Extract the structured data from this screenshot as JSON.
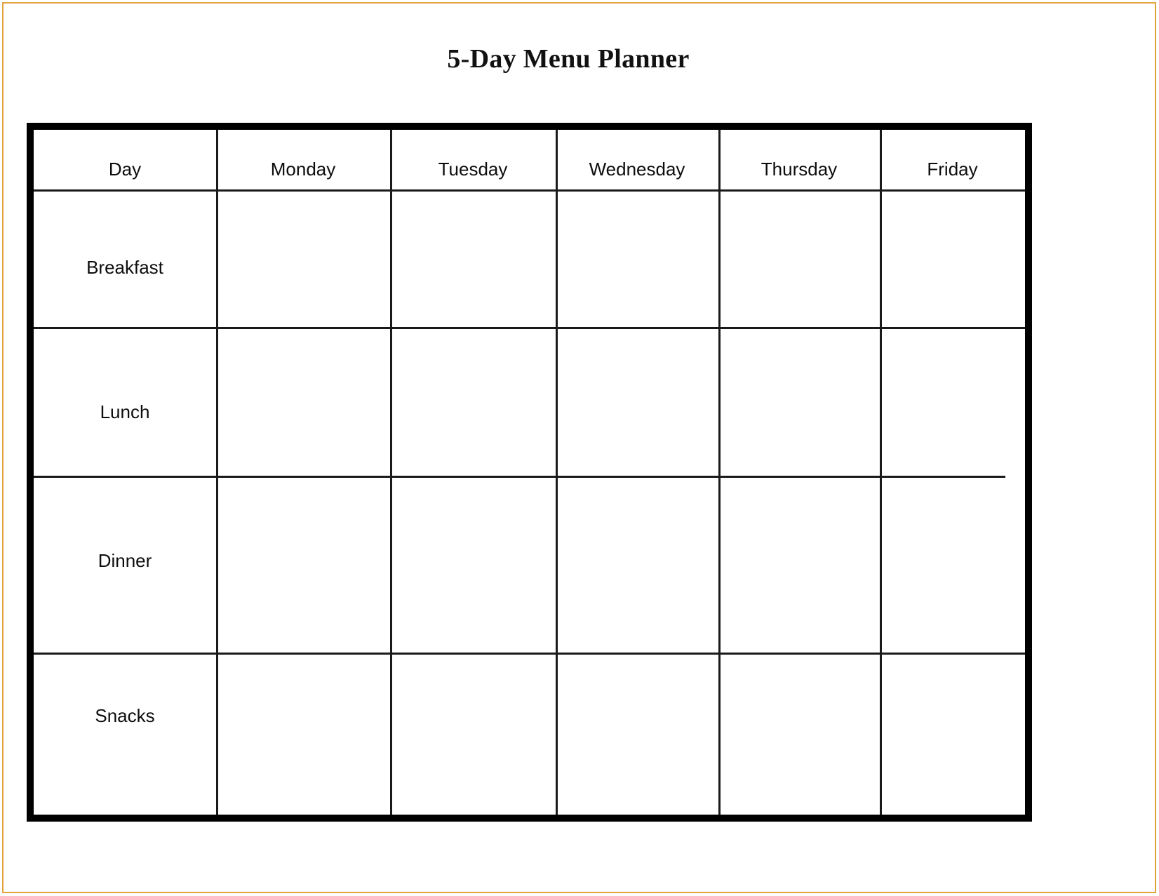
{
  "document": {
    "title": "5-Day Menu Planner",
    "frame_color": "#e0a33e",
    "border_color": "#000000"
  },
  "table": {
    "columns": [
      {
        "key": "day",
        "label": "Day"
      },
      {
        "key": "monday",
        "label": "Monday"
      },
      {
        "key": "tuesday",
        "label": "Tuesday"
      },
      {
        "key": "wednesday",
        "label": "Wednesday"
      },
      {
        "key": "thursday",
        "label": "Thursday"
      },
      {
        "key": "friday",
        "label": "Friday"
      }
    ],
    "rows": [
      {
        "label": "Breakfast",
        "cells": [
          "",
          "",
          "",
          "",
          ""
        ]
      },
      {
        "label": "Lunch",
        "cells": [
          "",
          "",
          "",
          "",
          ""
        ]
      },
      {
        "label": "Dinner",
        "cells": [
          "",
          "",
          "",
          "",
          ""
        ]
      },
      {
        "label": "Snacks",
        "cells": [
          "",
          "",
          "",
          "",
          ""
        ]
      }
    ]
  }
}
